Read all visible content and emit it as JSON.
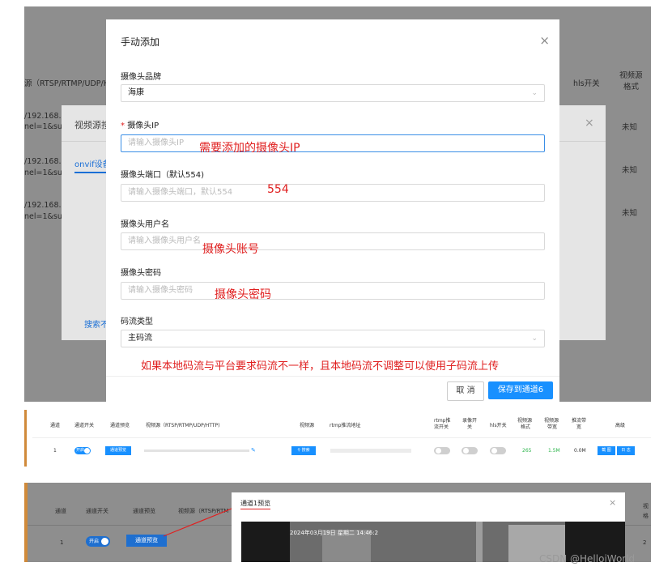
{
  "panel1": {
    "bg_headers": {
      "src_url": "源（RTSP/RTMP/UDP/H",
      "hls": "hls开关",
      "format_1": "视频源",
      "format_2": "格式"
    },
    "bg_rows": [
      {
        "url_1": "/192.168.0.",
        "url_2": "nel=1&sub",
        "format": "未知"
      },
      {
        "url_1": "/192.168.0.",
        "url_2": "nel=1&sub",
        "format": "未知"
      },
      {
        "url_1": "/192.168.0.",
        "url_2": "nel=1&sub",
        "format": "未知"
      }
    ],
    "dialog2": {
      "title": "视频源搜",
      "close": "×",
      "tab": "onvif设备",
      "search_link": "搜索不"
    },
    "dialog1": {
      "title": "手动添加",
      "close": "×",
      "brand": {
        "label": "摄像头品牌",
        "value": "海康"
      },
      "ip": {
        "required": "*",
        "label": "摄像头IP",
        "placeholder": "请输入摄像头IP",
        "annotation": "需要添加的摄像头IP"
      },
      "port": {
        "label": "摄像头端口（默认554)",
        "placeholder": "请输入摄像头端口，默认554",
        "annotation": "554"
      },
      "username": {
        "label": "摄像头用户名",
        "placeholder": "请输入摄像头用户名",
        "annotation": "摄像头账号"
      },
      "password": {
        "label": "摄像头密码",
        "placeholder": "请输入摄像头密码",
        "annotation": "摄像头密码"
      },
      "stream": {
        "label": "码流类型",
        "value": "主码流",
        "annotation": "如果本地码流与平台要求码流不一样，且本地码流不调整可以使用子码流上传"
      },
      "cancel": "取 消",
      "save": "保存到通道6"
    }
  },
  "panel2": {
    "headers": {
      "channel": "通道",
      "switch": "通道开关",
      "preview": "通道预览",
      "source": "视频源（RTSP/RTMP/UDP/HTTP)",
      "video_src": "视频源",
      "rtmp_addr": "rtmp推流地址",
      "rtmp_1": "rtmp推",
      "rtmp_2": "流开关",
      "rec_1": "录像开",
      "rec_2": "关",
      "hls": "hls开关",
      "fmt_1": "视频源",
      "fmt_2": "格式",
      "bw_1": "视频源",
      "bw_2": "带宽",
      "push_1": "推流带",
      "push_2": "宽",
      "ops": "高级"
    },
    "row": {
      "channel": "1",
      "switch_label": "开启",
      "preview_btn": "通道预览",
      "search_btn": "搜索",
      "format": "265",
      "bandwidth": "1.5M",
      "push_bw": "0.0M",
      "edit_btn": "截 图",
      "adv_btn": "日 志"
    }
  },
  "panel3": {
    "headers": {
      "channel": "通道",
      "switch": "通道开关",
      "preview": "通道预览",
      "source": "视频源（RTSP/RTM",
      "cut": "视",
      "cut2": "格"
    },
    "row": {
      "channel": "1",
      "switch_label": "开启",
      "preview_btn": "通道预览",
      "cut": "2"
    },
    "preview_dialog": {
      "title": "通道1预览",
      "close": "×",
      "timestamp": "2024年03月19日 星期二 14:46:2"
    }
  },
  "watermark": "CSDN @HelloiWorld"
}
